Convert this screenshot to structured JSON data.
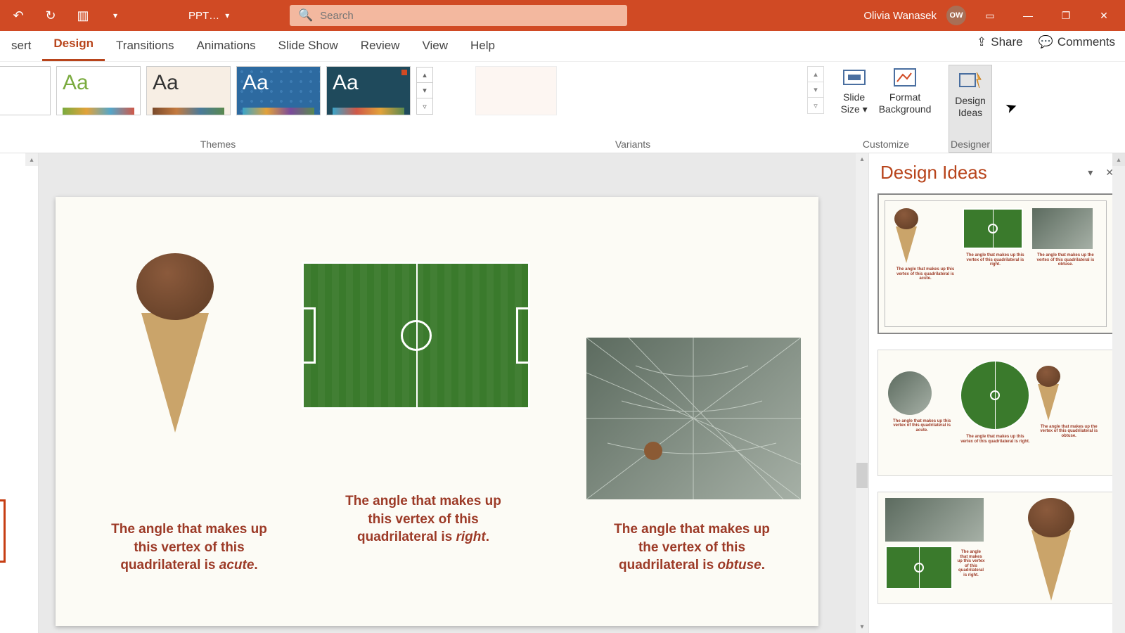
{
  "title_bar": {
    "filename": "PPT…",
    "search_placeholder": "Search",
    "user_name": "Olivia Wanasek",
    "user_initials": "OW"
  },
  "ribbon": {
    "tabs": [
      "sert",
      "Design",
      "Transitions",
      "Animations",
      "Slide Show",
      "Review",
      "View",
      "Help"
    ],
    "active_tab": "Design",
    "share": "Share",
    "comments": "Comments",
    "themes_label": "Themes",
    "variants_label": "Variants",
    "customize_label": "Customize",
    "designer_label": "Designer",
    "slide_size": "Slide\nSize ▾",
    "format_bg": "Format\nBackground",
    "design_ideas_btn": "Design\nIdeas"
  },
  "slide": {
    "caption1_a": "The angle that makes up this vertex of this quadrilateral  is ",
    "caption1_b": "acute",
    "caption2_a": "The angle that makes up this vertex of this quadrilateral  is ",
    "caption2_b": "right",
    "caption3_a": "The angle that makes up the vertex of this quadrilateral  is ",
    "caption3_b": "obtuse"
  },
  "design_pane": {
    "title": "Design Ideas",
    "mini_caption1": "The angle that makes up this vertex of this quadrilateral  is acute.",
    "mini_caption2": "The angle that makes up this vertex of this quadrilateral  is right.",
    "mini_caption3": "The angle that makes up the vertex of this quadrilateral  is obtuse."
  }
}
